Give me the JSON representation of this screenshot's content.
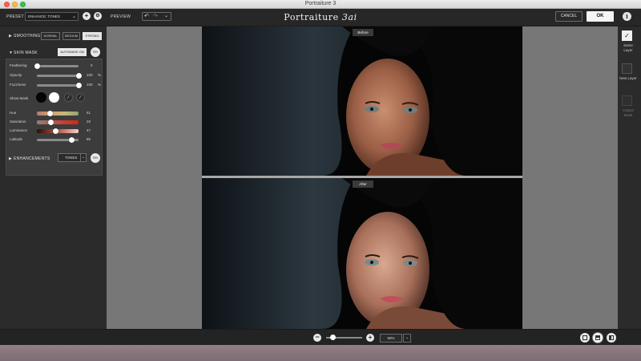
{
  "window": {
    "title": "Portraiture 3"
  },
  "toolbar": {
    "preset_label": "PRESET",
    "preset_value": "ENHANCE: TONES",
    "preview_label": "PREVIEW",
    "brand_main": "Portraiture",
    "brand_version": "3ai",
    "cancel_label": "CANCEL",
    "ok_label": "OK"
  },
  "smoothing": {
    "title": "SMOOTHING",
    "options": [
      "NORMAL",
      "MEDIUM",
      "STRONG"
    ],
    "selected": "STRONG"
  },
  "skin_mask": {
    "title": "SKIN MASK",
    "automask_label": "AUTOMASK ON",
    "on_label": "On",
    "sliders": [
      {
        "label": "Feathering",
        "value": "0",
        "unit": "",
        "fraction": 0.0
      },
      {
        "label": "Opacity",
        "value": "100",
        "unit": "%",
        "fraction": 1.0
      },
      {
        "label": "Fuzziness",
        "value": "100",
        "unit": "%",
        "fraction": 1.0
      }
    ],
    "show_mask_label": "Show Mask",
    "color_sliders": [
      {
        "label": "Hue",
        "value": "61",
        "fraction": 0.32
      },
      {
        "label": "Saturation",
        "value": "33",
        "fraction": 0.33
      },
      {
        "label": "Luminance",
        "value": "47",
        "fraction": 0.45
      },
      {
        "label": "Latitude",
        "value": "86",
        "fraction": 0.84
      }
    ]
  },
  "enhancements": {
    "title": "ENHANCEMENTS",
    "select_value": "TONES",
    "on_label": "On"
  },
  "preview": {
    "before_label": "Before",
    "after_label": "After"
  },
  "output": {
    "same_layer": "Same Layer",
    "new_layer": "New Layer",
    "output_mask": "Output Mask"
  },
  "zoom": {
    "value": "50%",
    "fraction": 0.18
  },
  "colors": {
    "panel": "#2b2b2b",
    "canvas": "#777777",
    "accent": "#e6e6e6"
  }
}
